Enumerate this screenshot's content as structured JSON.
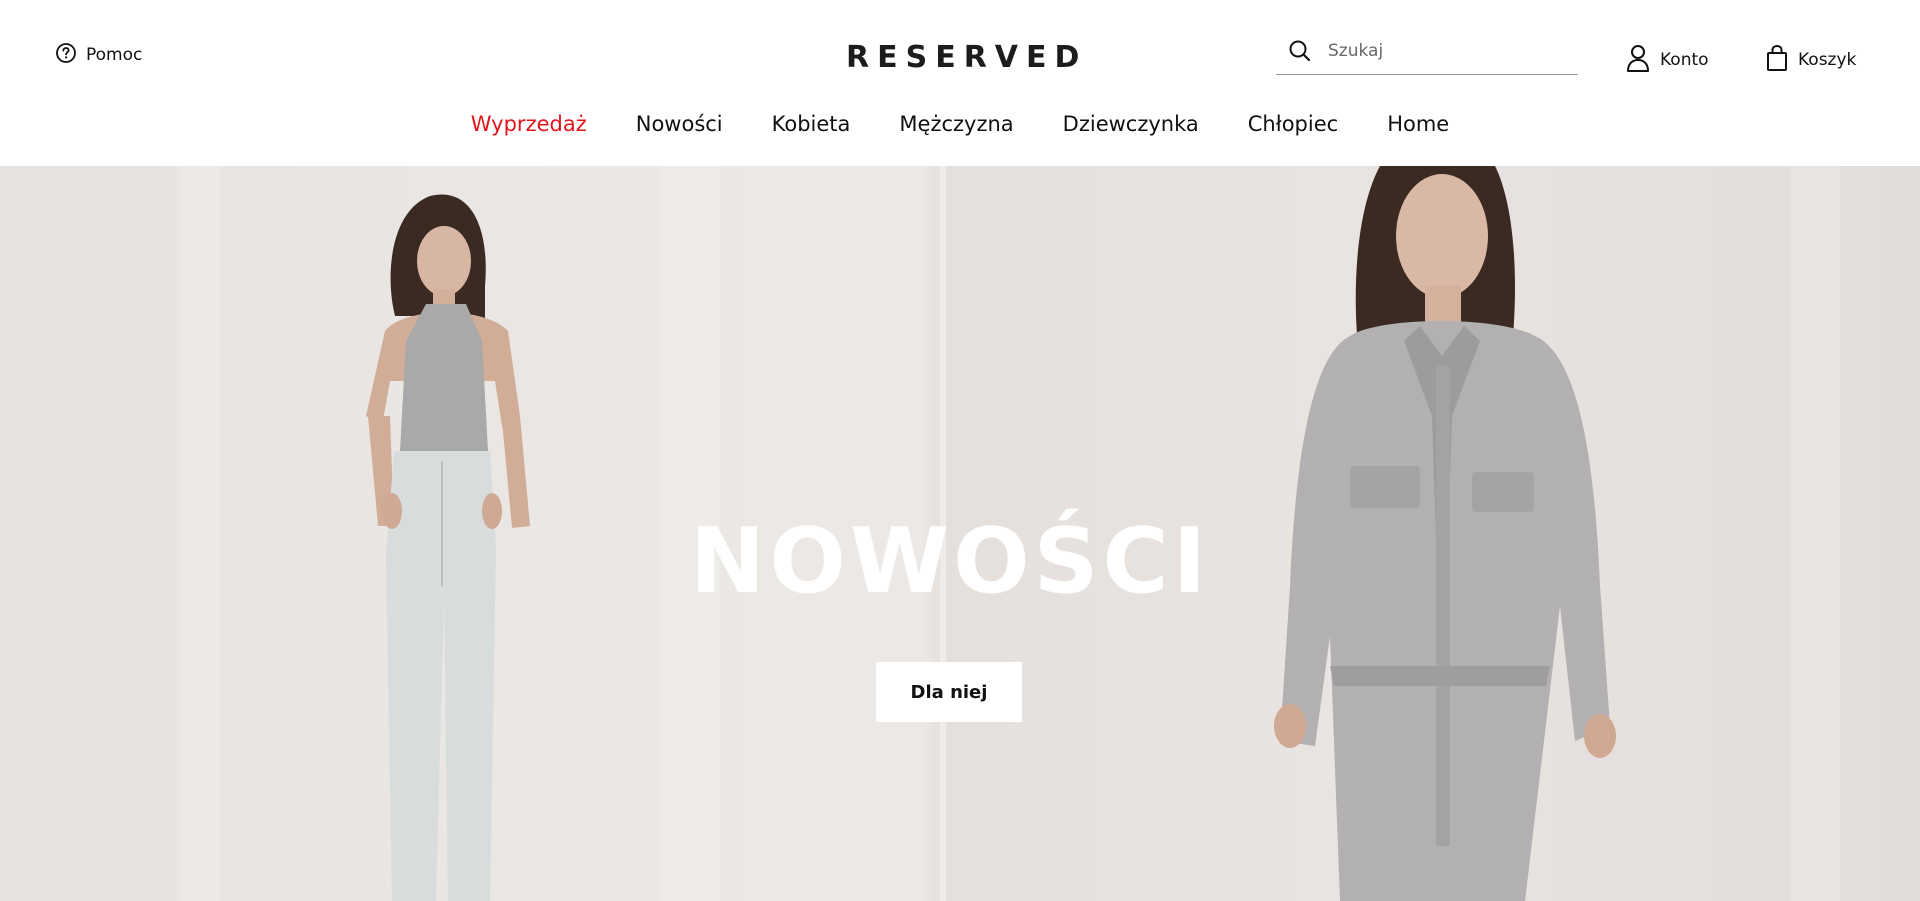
{
  "header": {
    "help_label": "Pomoc",
    "logo_text": "RESERVED",
    "search_placeholder": "Szukaj",
    "account_label": "Konto",
    "cart_label": "Koszyk"
  },
  "nav": {
    "items": [
      {
        "label": "Wyprzedaż",
        "color": "#e3151c"
      },
      {
        "label": "Nowości"
      },
      {
        "label": "Kobieta"
      },
      {
        "label": "Mężczyzna"
      },
      {
        "label": "Dziewczynka"
      },
      {
        "label": "Chłopiec"
      },
      {
        "label": "Home"
      }
    ]
  },
  "hero": {
    "title": "NOWOŚCI",
    "cta_label": "Dla niej"
  },
  "icons": {
    "help": "question-circle-icon",
    "search": "search-icon",
    "account": "user-icon",
    "cart": "shopping-bag-icon"
  }
}
